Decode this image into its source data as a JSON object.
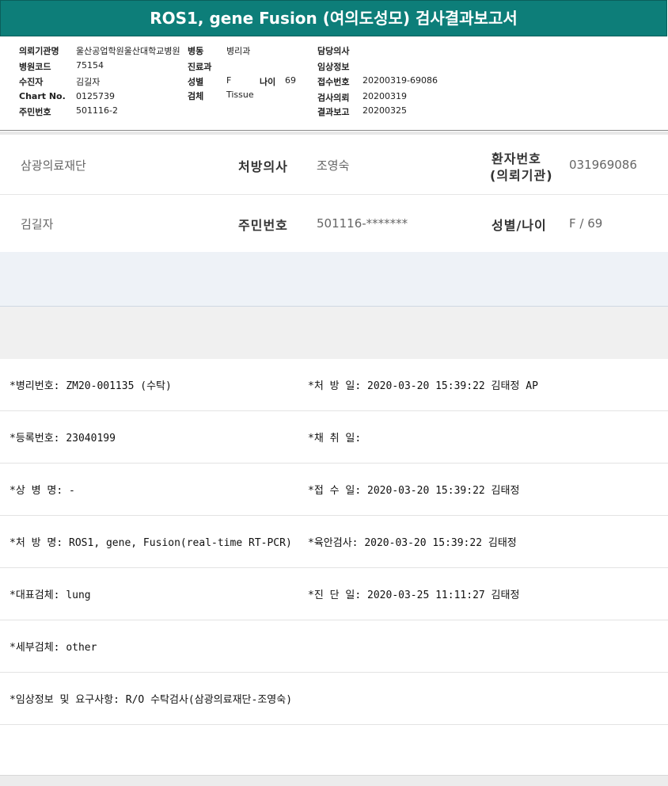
{
  "title": "ROS1, gene Fusion (여의도성모) 검사결과보고서",
  "header": {
    "inst_label": "의뢰기관명",
    "inst_value": "울산공업학원울산대학교병원",
    "ward_label": "병동",
    "ward_value": "병리과",
    "doctor_label": "담당의사",
    "code_label": "병원코드",
    "code_value": "75154",
    "dept_label": "진료과",
    "clinical_label": "임상정보",
    "receiver_label": "수진자",
    "receiver_value": "김길자",
    "sex_label": "성별",
    "sex_value": "F",
    "age_label": "나이",
    "age_value": "69",
    "accession_label": "접수번호",
    "accession_value": "20200319-69086",
    "chart_label": "Chart No.",
    "chart_value": "0125739",
    "specimen_label": "검체",
    "specimen_value": "Tissue",
    "request_label": "검사의뢰",
    "request_value": "20200319",
    "ssn_label": "주민번호",
    "ssn_value": "501116-2",
    "report_label": "결과보고",
    "report_value": "20200325"
  },
  "patient": {
    "org": "삼광의료재단",
    "doctor_label": "처방의사",
    "doctor": "조영숙",
    "pid_label_1": "환자번호",
    "pid_label_2": "(의뢰기관)",
    "pid": "031969086",
    "name": "김길자",
    "ssn_label": "주민번호",
    "ssn": "501116-*******",
    "sexage_label": "성별/나이",
    "sexage": "F / 69"
  },
  "details": {
    "path_no": "*병리번호: ZM20-001135 (수탁)",
    "rx_date": "*처 방 일: 2020-03-20 15:39:22  김태정 AP",
    "reg_no": "*등록번호: 23040199",
    "collect_date": "*채 취 일:",
    "diagnosis": "*상 병 명: -",
    "receive_date": "*접 수 일: 2020-03-20 15:39:22  김태정",
    "rx_name": "*처 방 명: ROS1, gene, Fusion(real-time RT-PCR)",
    "gross_exam": "*육안검사: 2020-03-20 15:39:22  김태정",
    "main_specimen": "*대표검체: lung",
    "dx_date": "*진 단 일: 2020-03-25 11:11:27  김태정",
    "sub_specimen": "*세부검체: other",
    "clinical_info": "*임상정보 및 요구사항: R/O 수탁검사(삼광의료재단-조영숙)"
  }
}
